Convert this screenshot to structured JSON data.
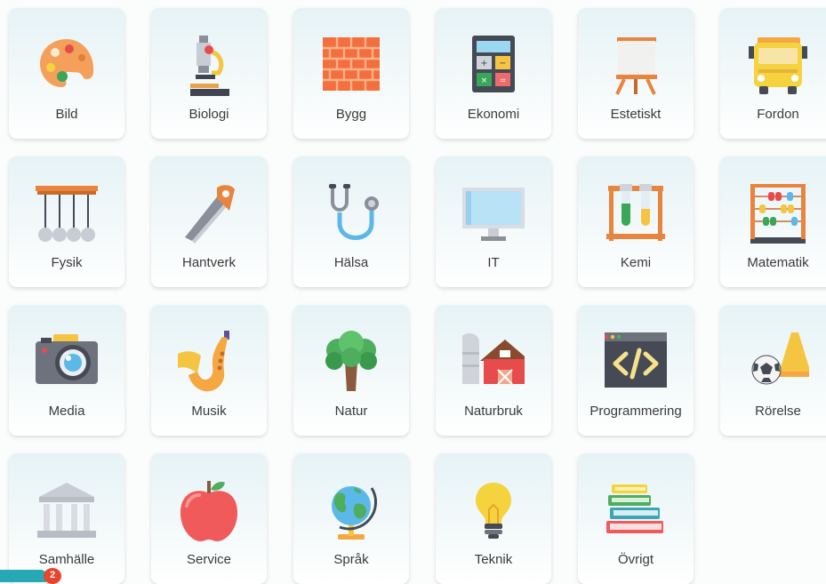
{
  "subjects": [
    {
      "label": "Bild",
      "icon": "palette-icon"
    },
    {
      "label": "Biologi",
      "icon": "microscope-icon"
    },
    {
      "label": "Bygg",
      "icon": "brick-wall-icon"
    },
    {
      "label": "Ekonomi",
      "icon": "calculator-icon"
    },
    {
      "label": "Estetiskt",
      "icon": "easel-icon"
    },
    {
      "label": "Fordon",
      "icon": "bus-icon"
    },
    {
      "label": "Fysik",
      "icon": "newtons-cradle-icon"
    },
    {
      "label": "Hantverk",
      "icon": "saw-icon"
    },
    {
      "label": "Hälsa",
      "icon": "stethoscope-icon"
    },
    {
      "label": "IT",
      "icon": "monitor-icon"
    },
    {
      "label": "Kemi",
      "icon": "test-tubes-icon"
    },
    {
      "label": "Matematik",
      "icon": "abacus-icon"
    },
    {
      "label": "Media",
      "icon": "camera-icon"
    },
    {
      "label": "Musik",
      "icon": "saxophone-icon"
    },
    {
      "label": "Natur",
      "icon": "tree-icon"
    },
    {
      "label": "Naturbruk",
      "icon": "barn-icon"
    },
    {
      "label": "Programmering",
      "icon": "code-window-icon"
    },
    {
      "label": "Rörelse",
      "icon": "soccer-ball-cone-icon"
    },
    {
      "label": "Samhälle",
      "icon": "government-building-icon"
    },
    {
      "label": "Service",
      "icon": "apple-icon"
    },
    {
      "label": "Språk",
      "icon": "globe-icon"
    },
    {
      "label": "Teknik",
      "icon": "lightbulb-icon"
    },
    {
      "label": "Övrigt",
      "icon": "book-stack-icon"
    }
  ],
  "chat": {
    "badge_count": "2",
    "icon": "chat-icon"
  },
  "colors": {
    "card_top": "#e6f3f6",
    "text": "#3a3a3a",
    "badge": "#e8442e",
    "chat": "#26a9b5"
  }
}
